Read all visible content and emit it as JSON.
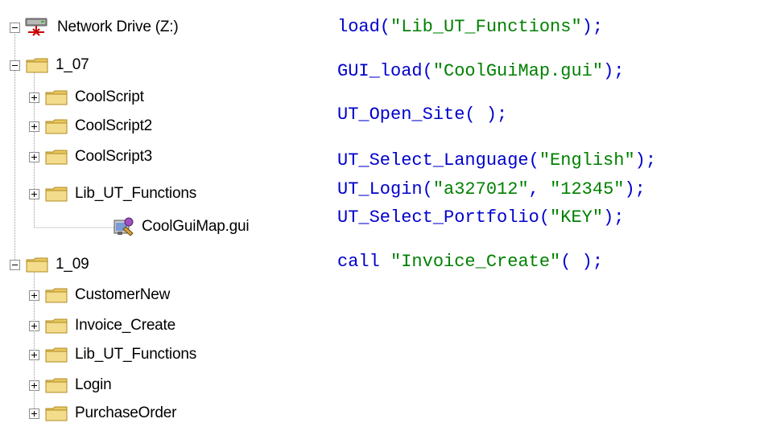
{
  "tree": {
    "root": {
      "label": "Network Drive (Z:)",
      "icon": "network-drive-icon"
    },
    "groups": [
      {
        "label": "1_07",
        "icon": "folder-icon",
        "children": [
          {
            "label": "CoolScript",
            "icon": "folder-icon"
          },
          {
            "label": "CoolScript2",
            "icon": "folder-icon"
          },
          {
            "label": "CoolScript3",
            "icon": "folder-icon"
          },
          {
            "label": "Lib_UT_Functions",
            "icon": "folder-icon"
          },
          {
            "label": "CoolGuiMap.gui",
            "icon": "gui-map-file-icon"
          }
        ]
      },
      {
        "label": "1_09",
        "icon": "folder-icon",
        "children": [
          {
            "label": "CustomerNew",
            "icon": "folder-icon"
          },
          {
            "label": "Invoice_Create",
            "icon": "folder-icon"
          },
          {
            "label": "Lib_UT_Functions",
            "icon": "folder-icon"
          },
          {
            "label": "Login",
            "icon": "folder-icon"
          },
          {
            "label": "PurchaseOrder",
            "icon": "folder-icon"
          }
        ]
      }
    ]
  },
  "code": {
    "lines": [
      {
        "fn": "load(",
        "str": "\"Lib_UT_Functions\"",
        "end": ");"
      },
      {
        "fn": "GUI_load(",
        "str": "\"CoolGuiMap.gui\"",
        "end": ");"
      },
      {
        "fn": "UT_Open_Site( );",
        "str": "",
        "end": ""
      },
      {
        "fn": "UT_Select_Language(",
        "str": "\"English\"",
        "end": ");"
      },
      {
        "fn": "UT_Login(",
        "str": "\"a327012\"",
        "mid": ", ",
        "str2": "\"12345\"",
        "end": ");"
      },
      {
        "fn": "UT_Select_Portfolio(",
        "str": "\"KEY\"",
        "end": ");"
      },
      {
        "fn": "call ",
        "str": "\"Invoice_Create\"",
        "end": "( );"
      }
    ]
  },
  "colors": {
    "function_text": "#0000cc",
    "string_literal": "#008000",
    "tree_text": "#000000",
    "tree_lines": "#8f8f8f",
    "folder_fill": "#f3dc8c"
  }
}
